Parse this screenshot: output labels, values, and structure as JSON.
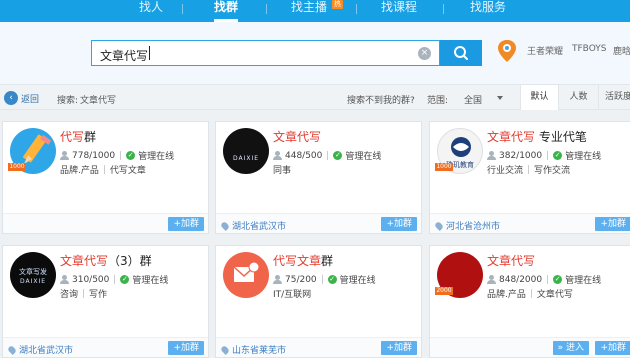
{
  "nav": {
    "items": [
      "找人",
      "找群",
      "找主播",
      "找课程",
      "找服务"
    ],
    "hot_badge": "热"
  },
  "search": {
    "query": "文章代写",
    "hot_words": [
      "王者荣耀",
      "TFBOYS",
      "鹿晗"
    ]
  },
  "subbar": {
    "back_label": "返回",
    "search_prefix": "搜索:",
    "search_term": "文章代写",
    "not_found": "搜索不到我的群?",
    "range_label": "范围:",
    "range_value": "全国",
    "sort_tabs": [
      "默认",
      "人数",
      "活跃度"
    ]
  },
  "cards": [
    {
      "name_highlight": "代写",
      "name_rest": "群",
      "members": "778/1000",
      "admin": "管理在线",
      "tags": [
        "品牌.产品",
        "代写文章"
      ],
      "location": "",
      "join": "+加群",
      "level_badge": "1000",
      "avatar_icon": "pencil-icon"
    },
    {
      "name_highlight": "文章代写",
      "name_rest": "",
      "members": "448/500",
      "admin": "管理在线",
      "tags": [
        "同事"
      ],
      "location": "湖北省武汉市",
      "join": "+加群",
      "avatar_text": "DAIXIE"
    },
    {
      "name_highlight": "文章代写",
      "name_rest": " 专业代笔",
      "members": "382/1000",
      "admin": "管理在线",
      "tags": [
        "行业交流",
        "写作交流"
      ],
      "location": "河北省沧州市",
      "join": "+加群",
      "level_badge": "1000",
      "avatar_text": "珠玑教育"
    },
    {
      "name_highlight": "文章代写",
      "name_rest": "（3）群",
      "members": "310/500",
      "admin": "管理在线",
      "tags": [
        "咨询",
        "写作"
      ],
      "location": "湖北省武汉市",
      "join": "+加群",
      "avatar_text": "文章写发",
      "avatar_subtext": "DAIXIE"
    },
    {
      "name_highlight": "代写文章",
      "name_rest": "群",
      "members": "75/200",
      "admin": "管理在线",
      "tags": [
        "IT/互联网"
      ],
      "location": "山东省莱芜市",
      "join": "+加群",
      "avatar_icon": "mail-icon"
    },
    {
      "name_highlight": "文章代写",
      "name_rest": "",
      "members": "848/2000",
      "admin": "管理在线",
      "tags": [
        "品牌.产品",
        "文章代写"
      ],
      "location": "",
      "join": "+加群",
      "enter": "进入",
      "level_badge": "2000"
    }
  ],
  "colors": {
    "brand": "#17a0e4",
    "highlight": "#e33a2e",
    "online": "#3cb34a",
    "join_button": "#5cb0ef"
  }
}
